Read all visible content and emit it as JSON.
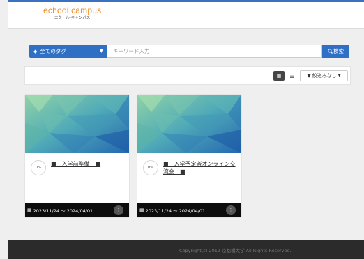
{
  "header": {
    "logo_main": "echool campus",
    "logo_sub": "エクール-キャンパス"
  },
  "search": {
    "tag_label": "全てのタグ",
    "keyword_placeholder": "キーワード入力",
    "search_label": "検索"
  },
  "toolbar": {
    "filter_label": "絞込みなし"
  },
  "courses": [
    {
      "title": "■　入学前準備　■",
      "progress": "0%",
      "period": "2023/11/24 ～ 2024/04/01"
    },
    {
      "title": "■　入学予定者オンライン交流会　■",
      "progress": "0%",
      "period": "2023/11/24 ～ 2024/04/01"
    }
  ],
  "footer": {
    "copyright": "Copyright(c) 2012 京都橘大学 All Rights Reserved."
  },
  "colors": {
    "accent": "#2f6fc4",
    "logo": "#f28c28",
    "footer_bg": "#2b2b2b"
  }
}
